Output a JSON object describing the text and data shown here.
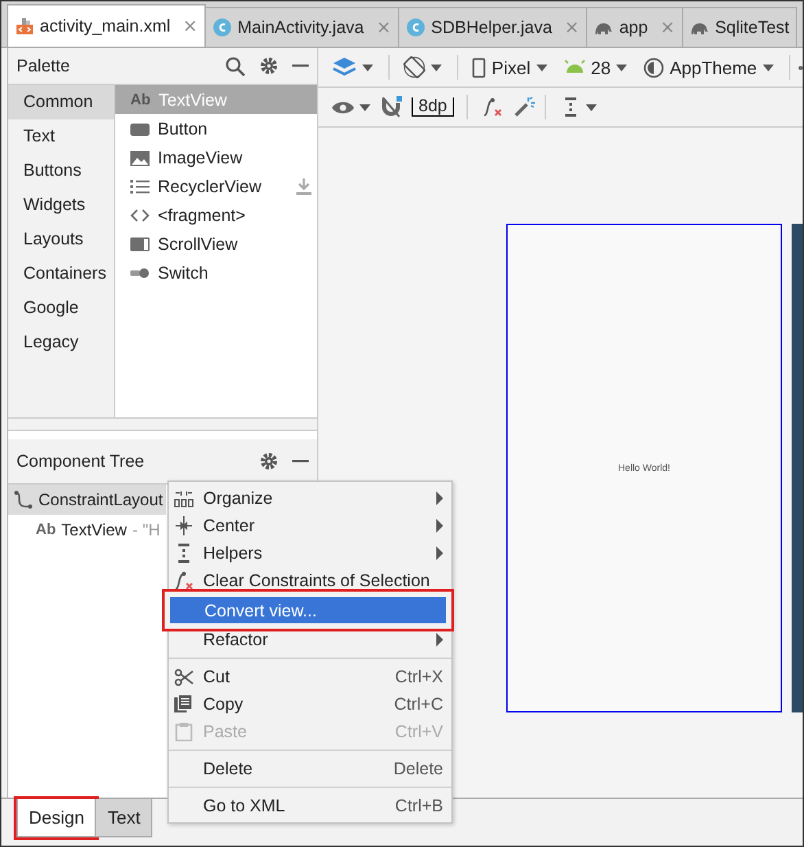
{
  "file_tabs": [
    {
      "label": "activity_main.xml",
      "kind": "xml",
      "close": "×",
      "selected": true
    },
    {
      "label": "MainActivity.java",
      "kind": "class",
      "close": "×",
      "selected": false
    },
    {
      "label": "SDBHelper.java",
      "kind": "class",
      "close": "×",
      "selected": false
    },
    {
      "label": "app",
      "kind": "gradle",
      "close": "×",
      "selected": false
    },
    {
      "label": "SqliteTest",
      "kind": "gradle",
      "selected": false
    }
  ],
  "palette": {
    "title": "Palette",
    "categories": [
      {
        "label": "Common",
        "selected": true
      },
      {
        "label": "Text",
        "selected": false
      },
      {
        "label": "Buttons",
        "selected": false
      },
      {
        "label": "Widgets",
        "selected": false
      },
      {
        "label": "Layouts",
        "selected": false
      },
      {
        "label": "Containers",
        "selected": false
      },
      {
        "label": "Google",
        "selected": false
      },
      {
        "label": "Legacy",
        "selected": false
      }
    ],
    "widgets": [
      {
        "label": "TextView",
        "kind": "text",
        "badge": "Ab",
        "selected": true,
        "download": false
      },
      {
        "label": "Button",
        "kind": "button",
        "selected": false,
        "download": false
      },
      {
        "label": "ImageView",
        "kind": "image",
        "selected": false,
        "download": false
      },
      {
        "label": "RecyclerView",
        "kind": "list",
        "selected": false,
        "download": true
      },
      {
        "label": "<fragment>",
        "kind": "code",
        "selected": false,
        "download": false
      },
      {
        "label": "ScrollView",
        "kind": "scroll",
        "selected": false,
        "download": false
      },
      {
        "label": "Switch",
        "kind": "switch",
        "selected": false,
        "download": false
      }
    ]
  },
  "toolbar": {
    "device": "Pixel",
    "api": "28",
    "theme": "AppTheme",
    "margin": "8dp"
  },
  "component_tree": {
    "title": "Component Tree",
    "items": [
      {
        "label": "ConstraintLayout",
        "kind": "constraint",
        "selected": true,
        "children": [
          {
            "label": "TextView",
            "detail": "- \"H",
            "kind": "text",
            "badge": "Ab",
            "selected": false
          }
        ]
      }
    ]
  },
  "preview": {
    "text": "Hello World!"
  },
  "context_menu": {
    "items": [
      {
        "kind": "organize",
        "label": "Organize",
        "submenu": true,
        "highlighted": false,
        "disabled": false,
        "outlined": false
      },
      {
        "kind": "center",
        "label": "Center",
        "submenu": true,
        "highlighted": false,
        "disabled": false,
        "outlined": false
      },
      {
        "kind": "helpers",
        "label": "Helpers",
        "submenu": true,
        "highlighted": false,
        "disabled": false,
        "outlined": false
      },
      {
        "kind": "clear",
        "label": "Clear Constraints of Selection",
        "submenu": false,
        "highlighted": false,
        "disabled": false,
        "outlined": false
      },
      {
        "kind": "plain",
        "label": "Convert view...",
        "submenu": false,
        "highlighted": true,
        "disabled": false,
        "outlined": true
      },
      {
        "kind": "plain",
        "label": "Refactor",
        "submenu": true,
        "highlighted": false,
        "disabled": false,
        "outlined": false
      },
      {
        "kind": "separator"
      },
      {
        "kind": "cut",
        "label": "Cut",
        "shortcut": "Ctrl+X",
        "submenu": false,
        "highlighted": false,
        "disabled": false,
        "outlined": false
      },
      {
        "kind": "copy",
        "label": "Copy",
        "shortcut": "Ctrl+C",
        "submenu": false,
        "highlighted": false,
        "disabled": false,
        "outlined": false
      },
      {
        "kind": "paste",
        "label": "Paste",
        "shortcut": "Ctrl+V",
        "submenu": false,
        "highlighted": false,
        "disabled": true,
        "outlined": false
      },
      {
        "kind": "separator"
      },
      {
        "kind": "plain",
        "label": "Delete",
        "shortcut": "Delete",
        "submenu": false,
        "highlighted": false,
        "disabled": false,
        "outlined": false
      },
      {
        "kind": "separator"
      },
      {
        "kind": "plain",
        "label": "Go to XML",
        "shortcut": "Ctrl+B",
        "submenu": false,
        "highlighted": false,
        "disabled": false,
        "outlined": false
      }
    ]
  },
  "bottom_tabs": [
    {
      "label": "Design",
      "selected": true,
      "outlined": true
    },
    {
      "label": "Text",
      "selected": false,
      "outlined": false
    }
  ]
}
